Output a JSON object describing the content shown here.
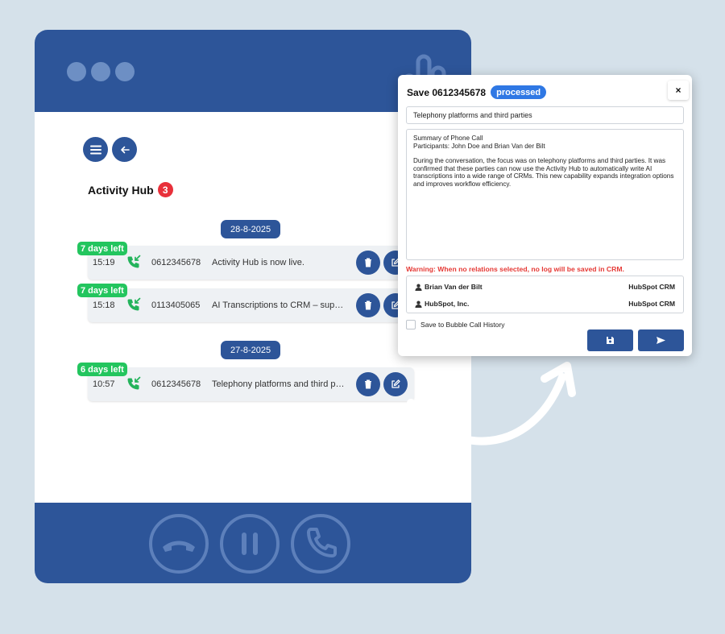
{
  "colors": {
    "brand": "#2d5599",
    "badge_red": "#e8303a",
    "days_green": "#23c55e",
    "status_blue": "#2f78e4",
    "warning_red": "#e53935"
  },
  "hub": {
    "title": "Activity Hub",
    "badge_count": "3"
  },
  "groups": [
    {
      "date": "28-8-2025"
    },
    {
      "date": "27-8-2025"
    }
  ],
  "calls": [
    {
      "days_left": "7 days left",
      "time": "15:19",
      "number": "0612345678",
      "description": "Activity Hub is now live."
    },
    {
      "days_left": "7 days left",
      "time": "15:18",
      "number": "0113405065",
      "description": "AI Transcriptions to CRM – supported by Activity Hub"
    },
    {
      "days_left": "6 days left",
      "time": "10:57",
      "number": "0612345678",
      "description": "Telephony platforms and third parties"
    }
  ],
  "modal": {
    "title": "Save 0612345678",
    "status": "processed",
    "close": "×",
    "subject": "Telephony platforms and third parties",
    "body": {
      "line1": "Summary of Phone Call",
      "line2": "Participants: John Doe and Brian Van der Bilt",
      "paragraph": "During the conversation, the focus was on telephony platforms and third parties. It was confirmed that these parties can now use the Activity Hub to automatically write AI transcriptions into a wide range of CRMs. This new capability expands integration options and improves workflow efficiency."
    },
    "warning": "Warning: When no relations selected, no log will be saved in CRM.",
    "relations": [
      {
        "name": "Brian Van der Bilt",
        "crm": "HubSpot CRM"
      },
      {
        "name": "HubSpot, Inc.",
        "crm": "HubSpot CRM"
      }
    ],
    "checkbox_label": "Save to Bubble Call History"
  },
  "icons": {
    "menu": "menu-icon",
    "back": "arrow-left-icon",
    "call": "incoming-call-icon",
    "delete": "trash-icon",
    "edit": "edit-icon",
    "user": "user-icon",
    "save": "floppy-disk-icon",
    "send": "send-icon",
    "hangup": "hang-up-icon",
    "pause": "pause-icon",
    "phone": "phone-icon"
  }
}
